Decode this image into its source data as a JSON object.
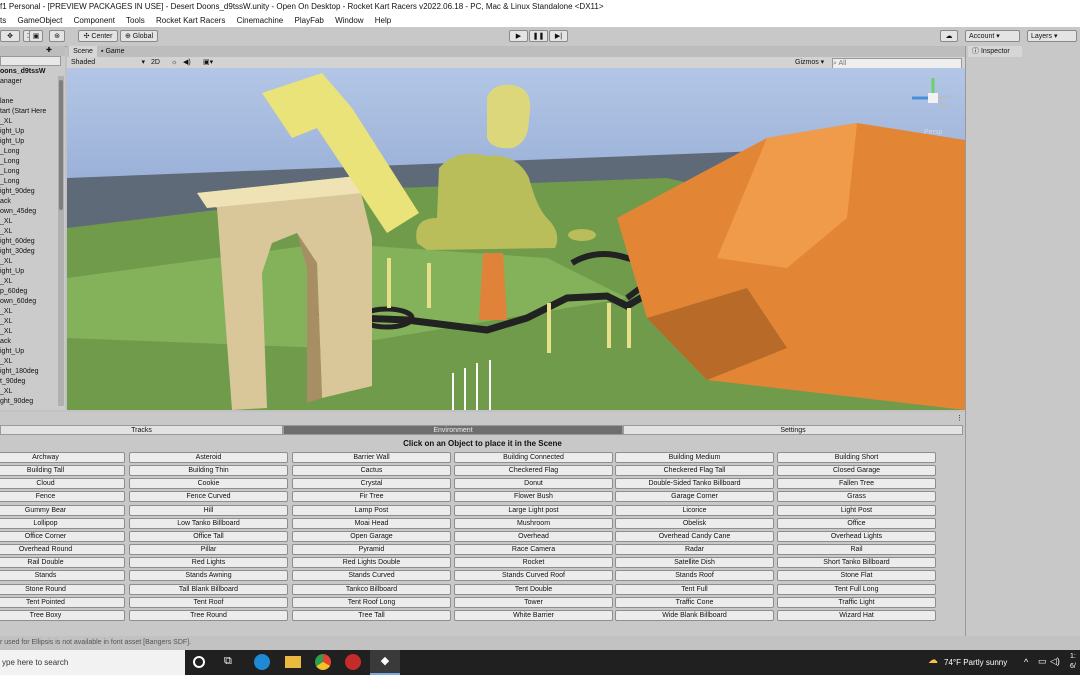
{
  "window": {
    "title": "f1 Personal - [PREVIEW PACKAGES IN USE] - Desert Doons_d9tssW.unity - Open On Desktop - Rocket Kart Racers v2022.06.18 - PC, Mac & Linux Standalone <DX11>"
  },
  "menu": [
    "ts",
    "GameObject",
    "Component",
    "Tools",
    "Rocket Kart Racers",
    "Cinemachine",
    "PlayFab",
    "Window",
    "Help"
  ],
  "toolbar": {
    "center_label": "Center",
    "global_label": "Global",
    "account_label": "Account",
    "layers_label": "Layers"
  },
  "hierarchy": {
    "root": "oons_d9tssW",
    "items": [
      "anager",
      "",
      "lane",
      "tart (Start Here",
      "_XL",
      "ight_Up",
      "ight_Up",
      "_Long",
      "_Long",
      "_Long",
      "_Long",
      "ight_90deg",
      "ack",
      "own_45deg",
      "_XL",
      "_XL",
      "ight_60deg",
      "ight_30deg",
      "_XL",
      "ight_Up",
      "_XL",
      "p_60deg",
      "own_60deg",
      "_XL",
      "_XL",
      "_XL",
      "ack",
      "ight_Up",
      "_XL",
      "ight_180deg",
      "t_90deg",
      "_XL",
      "ght_90deg"
    ]
  },
  "scene": {
    "tabs": [
      "Scene",
      "Game"
    ],
    "shading": "Shaded",
    "mode_2d": "2D",
    "gizmos_label": "Gizmos",
    "search_placeholder": "All",
    "persp_label": "Persp"
  },
  "inspector": {
    "tab_label": "Inspector"
  },
  "tool_window": {
    "tabs": [
      "Tracks",
      "Environment",
      "Settings"
    ],
    "active_tab": "Environment",
    "instruction": "Click on an Object to place it in the Scene",
    "objects": [
      "Archway",
      "Asteroid",
      "Barrier Wall",
      "Building Connected",
      "Building Medium",
      "Building Short",
      "Building Tall",
      "Building Thin",
      "Cactus",
      "Checkered Flag",
      "Checkered Flag Tall",
      "Closed Garage",
      "Cloud",
      "Cookie",
      "Crystal",
      "Donut",
      "Double-Sided Tanko Billboard",
      "Fallen Tree",
      "Fence",
      "Fence Curved",
      "Fir Tree",
      "Flower Bush",
      "Garage Corner",
      "Grass",
      "Gummy Bear",
      "Hill",
      "Lamp Post",
      "Large Light post",
      "Licorice",
      "Light Post",
      "Lollipop",
      "Low Tanko Billboard",
      "Moai Head",
      "Mushroom",
      "Obelisk",
      "Office",
      "Office Corner",
      "Office Tall",
      "Open Garage",
      "Overhead",
      "Overhead Candy Cane",
      "Overhead Lights",
      "Overhead Round",
      "Pillar",
      "Pyramid",
      "Race Camera",
      "Radar",
      "Rail",
      "Rail Double",
      "Red Lights",
      "Red Lights Double",
      "Rocket",
      "Satellite Dish",
      "Short Tanko Billboard",
      "Stands",
      "Stands Awning",
      "Stands Curved",
      "Stands Curved Roof",
      "Stands Roof",
      "Stone Flat",
      "Stone Round",
      "Tall Blank Billboard",
      "Tankco Billboard",
      "Tent Double",
      "Tent Full",
      "Tent Full Long",
      "Tent Pointed",
      "Tent Roof",
      "Tent Roof Long",
      "Tower",
      "Traffic Cone",
      "Traffic Light",
      "Tree Boxy",
      "Tree Round",
      "Tree Tall",
      "White Barrier",
      "Wide Blank Billboard",
      "Wizard Hat"
    ]
  },
  "status": {
    "message": "r used for Ellipsis is not available in font asset [Bangers SDF]."
  },
  "taskbar": {
    "search_placeholder": "ype here to search",
    "weather_temp": "74°F",
    "weather_text": "Partly sunny",
    "clock_time": "1:",
    "clock_date": "6/"
  },
  "colors": {
    "sky": "#8fa8d6",
    "ground": "#6a9a4e",
    "rock": "#d97a2e",
    "accent": "#4a8fd8"
  }
}
